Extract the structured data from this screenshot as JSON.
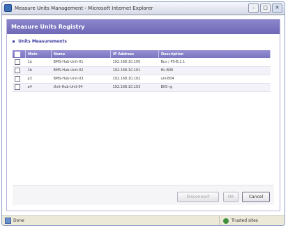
{
  "window": {
    "title": "Measure Units Management - Microsoft Internet Explorer",
    "minimize": "–",
    "maximize": "□",
    "close": "✕"
  },
  "page": {
    "header": "Measure Units Registry",
    "section_link": "Units Measurements",
    "table": {
      "columns": [
        "Main",
        "Name",
        "IP Address",
        "Description"
      ],
      "rows": [
        {
          "main": "1a",
          "name": "BMS-Hub-Unit-01",
          "ip": "192.168.10.100",
          "desc": "Bus / PS-B.2.1"
        },
        {
          "main": "1b",
          "name": "BMS-Hub-Unit-02",
          "ip": "192.168.10.101",
          "desc": "HL-B06"
        },
        {
          "main": "a3",
          "name": "BMS-Hub-Unit-03",
          "ip": "192.168.10.102",
          "desc": "uni-B04"
        },
        {
          "main": "a4",
          "name": "Unit-Hub-Unit-04",
          "ip": "192.168.10.103",
          "desc": "B05-rg"
        }
      ]
    },
    "buttons": {
      "disabled1": "Disconnect",
      "disabled2": "OK",
      "active": "Cancel"
    }
  },
  "statusbar": {
    "left": "Done",
    "right": "Trusted sites"
  }
}
